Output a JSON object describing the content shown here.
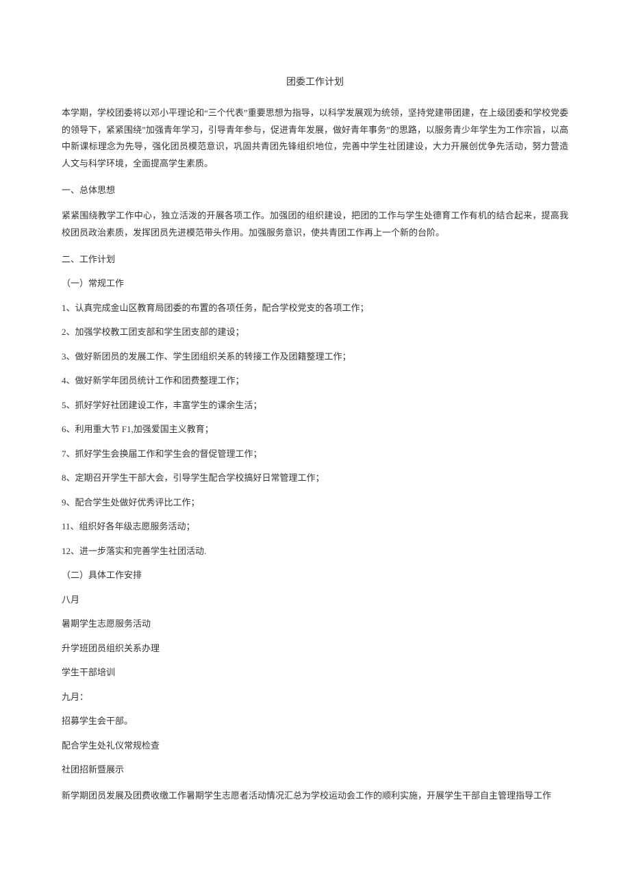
{
  "title": "团委工作计划",
  "intro": "本学期，学校团委将以邓小平理论和“三个代表”重要思想为指导，以科学发展观为统领，坚持党建带团建，在上级团委和学校党委的领导下，紧紧围绕”加强青年学习，引导青年参与，促进青年发展，做好青年事务”的思路，以服务青少年学生为工作宗旨，以高中新课标理念为先导，强化团员模范意识，巩固共青团先锋组织地位，完善中学生社团建设，大力开展创优争先活动，努力营造人文与科学环境，全面提高学生素质。",
  "sec1_heading": "一、总体思想",
  "sec1_body": "紧紧围绕教学工作中心，独立活泼的开展各项工作。加强团的组织建设，把团的工作与学生处德育工作有机的结合起来，提高我校团员政治素质，发挥团员先进模范带头作用。加强服务意识，使共青团工作再上一个新的台阶。",
  "sec2_heading": "二、工作计划",
  "sub1_heading": "（一）常规工作",
  "routine": [
    "1、认真完成金山区教育局团委的布置的各项任务，配合学校党支的各项工作；",
    "2、加强学校教工团支部和学生团支部的建设；",
    "3、做好新团员的发展工作、学生团组织关系的转接工作及团籍整理工作；",
    "4、做好新学年团员统计工作和团费整理工作；",
    "5、抓好学好社团建设工作，丰富学生的课余生活；",
    "6、利用重大节 F1,加强爱国主义教育；",
    "7、抓好学生会换届工作和学生会的督促管理工作；",
    "8、定期召开学生干部大会，引导学生配合学校搞好日常管理工作；",
    "9、配合学生处做好优秀评比工作；",
    "11、组织好各年级志愿服务活动；",
    "12、进一步落实和完善学生社团活动."
  ],
  "sub2_heading": "（二）具体工作安排",
  "schedule": [
    "八月",
    "暑期学生志愿服务活动",
    "升学班团员组织关系办理",
    "学生干部培训",
    "九月：",
    "招募学生会干部。",
    "配合学生处礼仪常规检查",
    "社团招新暨展示",
    "新学期团员发展及团费收缴工作暑期学生志愿者活动情况汇总为学校运动会工作的顺利实施，开展学生干部自主管理指导工作"
  ]
}
